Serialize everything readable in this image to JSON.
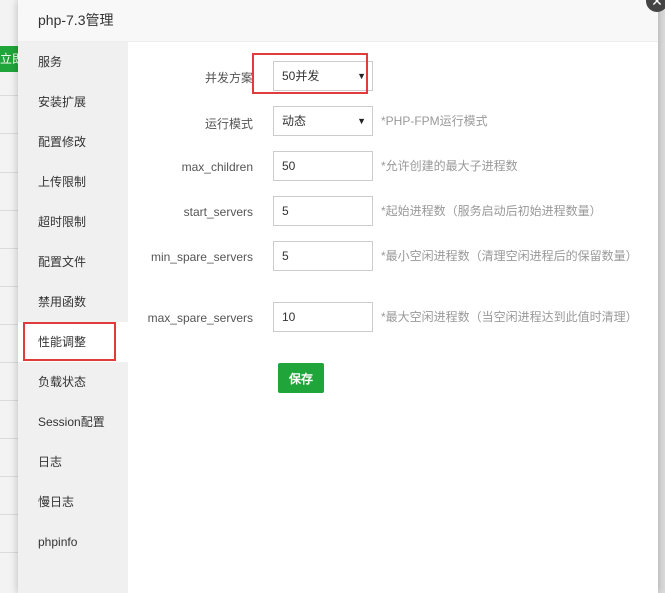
{
  "background": {
    "green_button_label": "立即"
  },
  "modal": {
    "title": "php-7.3管理",
    "close_icon": "close-icon"
  },
  "sidebar": {
    "items": [
      {
        "label": "服务"
      },
      {
        "label": "安装扩展"
      },
      {
        "label": "配置修改"
      },
      {
        "label": "上传限制"
      },
      {
        "label": "超时限制"
      },
      {
        "label": "配置文件"
      },
      {
        "label": "禁用函数"
      },
      {
        "label": "性能调整"
      },
      {
        "label": "负载状态"
      },
      {
        "label": "Session配置"
      },
      {
        "label": "日志"
      },
      {
        "label": "慢日志"
      },
      {
        "label": "phpinfo"
      }
    ],
    "active_index": 7
  },
  "form": {
    "concurrency": {
      "label": "并发方案",
      "value": "50并发"
    },
    "run_mode": {
      "label": "运行模式",
      "value": "动态",
      "hint": "*PHP-FPM运行模式"
    },
    "max_children": {
      "label": "max_children",
      "value": "50",
      "hint": "*允许创建的最大子进程数"
    },
    "start_servers": {
      "label": "start_servers",
      "value": "5",
      "hint": "*起始进程数（服务启动后初始进程数量）"
    },
    "min_spare_servers": {
      "label": "min_spare_servers",
      "value": "5",
      "hint": "*最小空闲进程数（清理空闲进程后的保留数量）"
    },
    "max_spare_servers": {
      "label": "max_spare_servers",
      "value": "10",
      "hint": "*最大空闲进程数（当空闲进程达到此值时清理）"
    },
    "save_label": "保存"
  },
  "colors": {
    "accent_green": "#20a53a",
    "highlight_red": "#e03c3c"
  }
}
